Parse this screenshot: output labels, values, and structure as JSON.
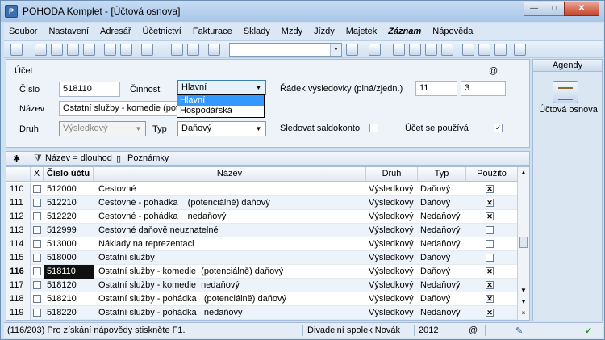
{
  "window": {
    "title": "POHODA Komplet - [Účtová osnova]",
    "app_icon": "P",
    "minimize": "—",
    "maximize": "□",
    "close": "✕"
  },
  "menu": [
    "Soubor",
    "Nastavení",
    "Adresář",
    "Účetnictví",
    "Fakturace",
    "Sklady",
    "Mzdy",
    "Jízdy",
    "Majetek",
    "Záznam",
    "Nápověda"
  ],
  "form": {
    "section_label": "Účet",
    "at_symbol": "@",
    "cislo_label": "Číslo",
    "cislo_value": "518110",
    "cinnost_label": "Činnost",
    "cinnost_value": "Hlavní",
    "cinnost_options": [
      "Hlavní",
      "Hospodářská"
    ],
    "nazev_label": "Název",
    "nazev_value": "Ostatní služby - komedie  (pote",
    "druh_label": "Druh",
    "druh_value": "Výsledkový",
    "typ_label": "Typ",
    "typ_value": "Daňový",
    "radek_label": "Řádek výsledovky (plná/zjedn.)",
    "radek_full": "11",
    "radek_simple": "3",
    "saldo_label": "Sledovat saldokonto",
    "pouziva_label": "Účet se používá",
    "pouziva_checked": "✓"
  },
  "agendy": {
    "header": "Agendy",
    "item_label": "Účtová osnova"
  },
  "tabs": {
    "star": "✱",
    "filter": "Název = dlouhod",
    "notes": "Poznámky"
  },
  "grid": {
    "headers": {
      "x": "X",
      "cislo": "Číslo účtu",
      "nazev": "Název",
      "druh": "Druh",
      "typ": "Typ",
      "pouzito": "Použito"
    },
    "rows": [
      {
        "n": "110",
        "num": "512000",
        "name": "Cestovné",
        "druh": "Výsledkový",
        "typ": "Daňový",
        "used": "✕"
      },
      {
        "n": "111",
        "num": "512210",
        "name": "Cestovné - pohádka    (potenciálně) daňový",
        "druh": "Výsledkový",
        "typ": "Daňový",
        "used": "✕"
      },
      {
        "n": "112",
        "num": "512220",
        "name": "Cestovné - pohádka    nedaňový",
        "druh": "Výsledkový",
        "typ": "Nedaňový",
        "used": "✕"
      },
      {
        "n": "113",
        "num": "512999",
        "name": "Cestovné daňově neuznatelné",
        "druh": "Výsledkový",
        "typ": "Nedaňový",
        "used": ""
      },
      {
        "n": "114",
        "num": "513000",
        "name": "Náklady na reprezentaci",
        "druh": "Výsledkový",
        "typ": "Nedaňový",
        "used": ""
      },
      {
        "n": "115",
        "num": "518000",
        "name": "Ostatní služby",
        "druh": "Výsledkový",
        "typ": "Daňový",
        "used": ""
      },
      {
        "n": "116",
        "num": "518110",
        "name": "Ostatní služby - komedie  (potenciálně) daňový",
        "druh": "Výsledkový",
        "typ": "Daňový",
        "used": "✕"
      },
      {
        "n": "117",
        "num": "518120",
        "name": "Ostatní služby - komedie  nedaňový",
        "druh": "Výsledkový",
        "typ": "Nedaňový",
        "used": "✕"
      },
      {
        "n": "118",
        "num": "518210",
        "name": "Ostatní služby - pohádka   (potenciálně) daňový",
        "druh": "Výsledkový",
        "typ": "Daňový",
        "used": "✕"
      },
      {
        "n": "119",
        "num": "518220",
        "name": "Ostatní služby - pohádka   nedaňový",
        "druh": "Výsledkový",
        "typ": "Nedaňový",
        "used": "✕"
      }
    ]
  },
  "status": {
    "position": "(116/203) Pro získání nápovědy stiskněte F1.",
    "company": "Divadelní spolek Novák",
    "year": "2012",
    "at": "@",
    "ok": "✓"
  }
}
